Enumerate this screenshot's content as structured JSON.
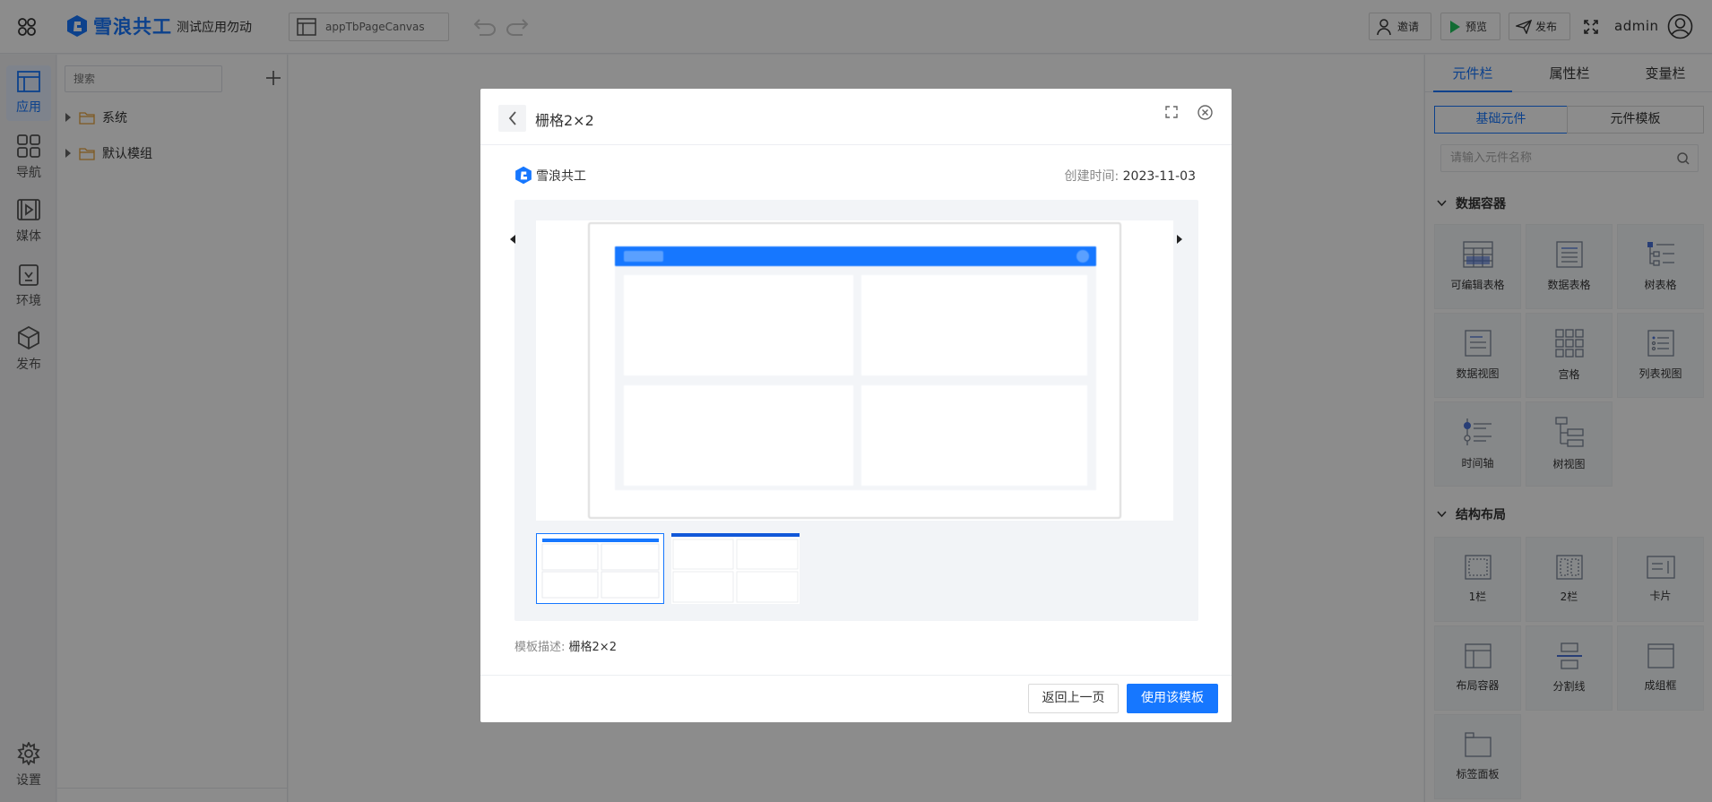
{
  "header": {
    "brand": "雪浪共工",
    "app_name": "测试应用勿动",
    "canvas_name": "appTbPageCanvas",
    "invite_label": "邀请",
    "preview_label": "预览",
    "publish_label": "发布",
    "user": "admin",
    "accent_color": "#1677ff",
    "preview_icon_color": "#22c55e"
  },
  "rail": {
    "items": [
      {
        "label": "应用",
        "icon": "layout-icon",
        "active": true
      },
      {
        "label": "导航",
        "icon": "grid-icon",
        "active": false
      },
      {
        "label": "媒体",
        "icon": "film-icon",
        "active": false
      },
      {
        "label": "环境",
        "icon": "clipboard-icon",
        "active": false
      },
      {
        "label": "发布",
        "icon": "cube-icon",
        "active": false
      }
    ],
    "settings_label": "设置"
  },
  "tree": {
    "search_placeholder": "搜索",
    "nodes": [
      {
        "label": "系统"
      },
      {
        "label": "默认模组"
      }
    ]
  },
  "right_panel": {
    "tabs": [
      "元件栏",
      "属性栏",
      "变量栏"
    ],
    "active_tab": "元件栏",
    "segments": [
      "基础元件",
      "元件模板"
    ],
    "active_segment": "基础元件",
    "search_placeholder": "请输入元件名称",
    "sections": [
      {
        "title": "数据容器",
        "items": [
          "可编辑表格",
          "数据表格",
          "树表格",
          "数据视图",
          "宫格",
          "列表视图",
          "时间轴",
          "树视图"
        ]
      },
      {
        "title": "结构布局",
        "items": [
          "1栏",
          "2栏",
          "卡片",
          "布局容器",
          "分割线",
          "成组框",
          "标签面板"
        ]
      }
    ]
  },
  "modal": {
    "title": "栅格2×2",
    "brand": "雪浪共工",
    "created_label": "创建时间:",
    "created_value": "2023-11-03",
    "desc_label": "模板描述:",
    "desc_value": "栅格2×2",
    "back_button": "返回上一页",
    "use_button": "使用该模板",
    "thumbnails": [
      {
        "selected": true
      },
      {
        "selected": false
      }
    ]
  }
}
